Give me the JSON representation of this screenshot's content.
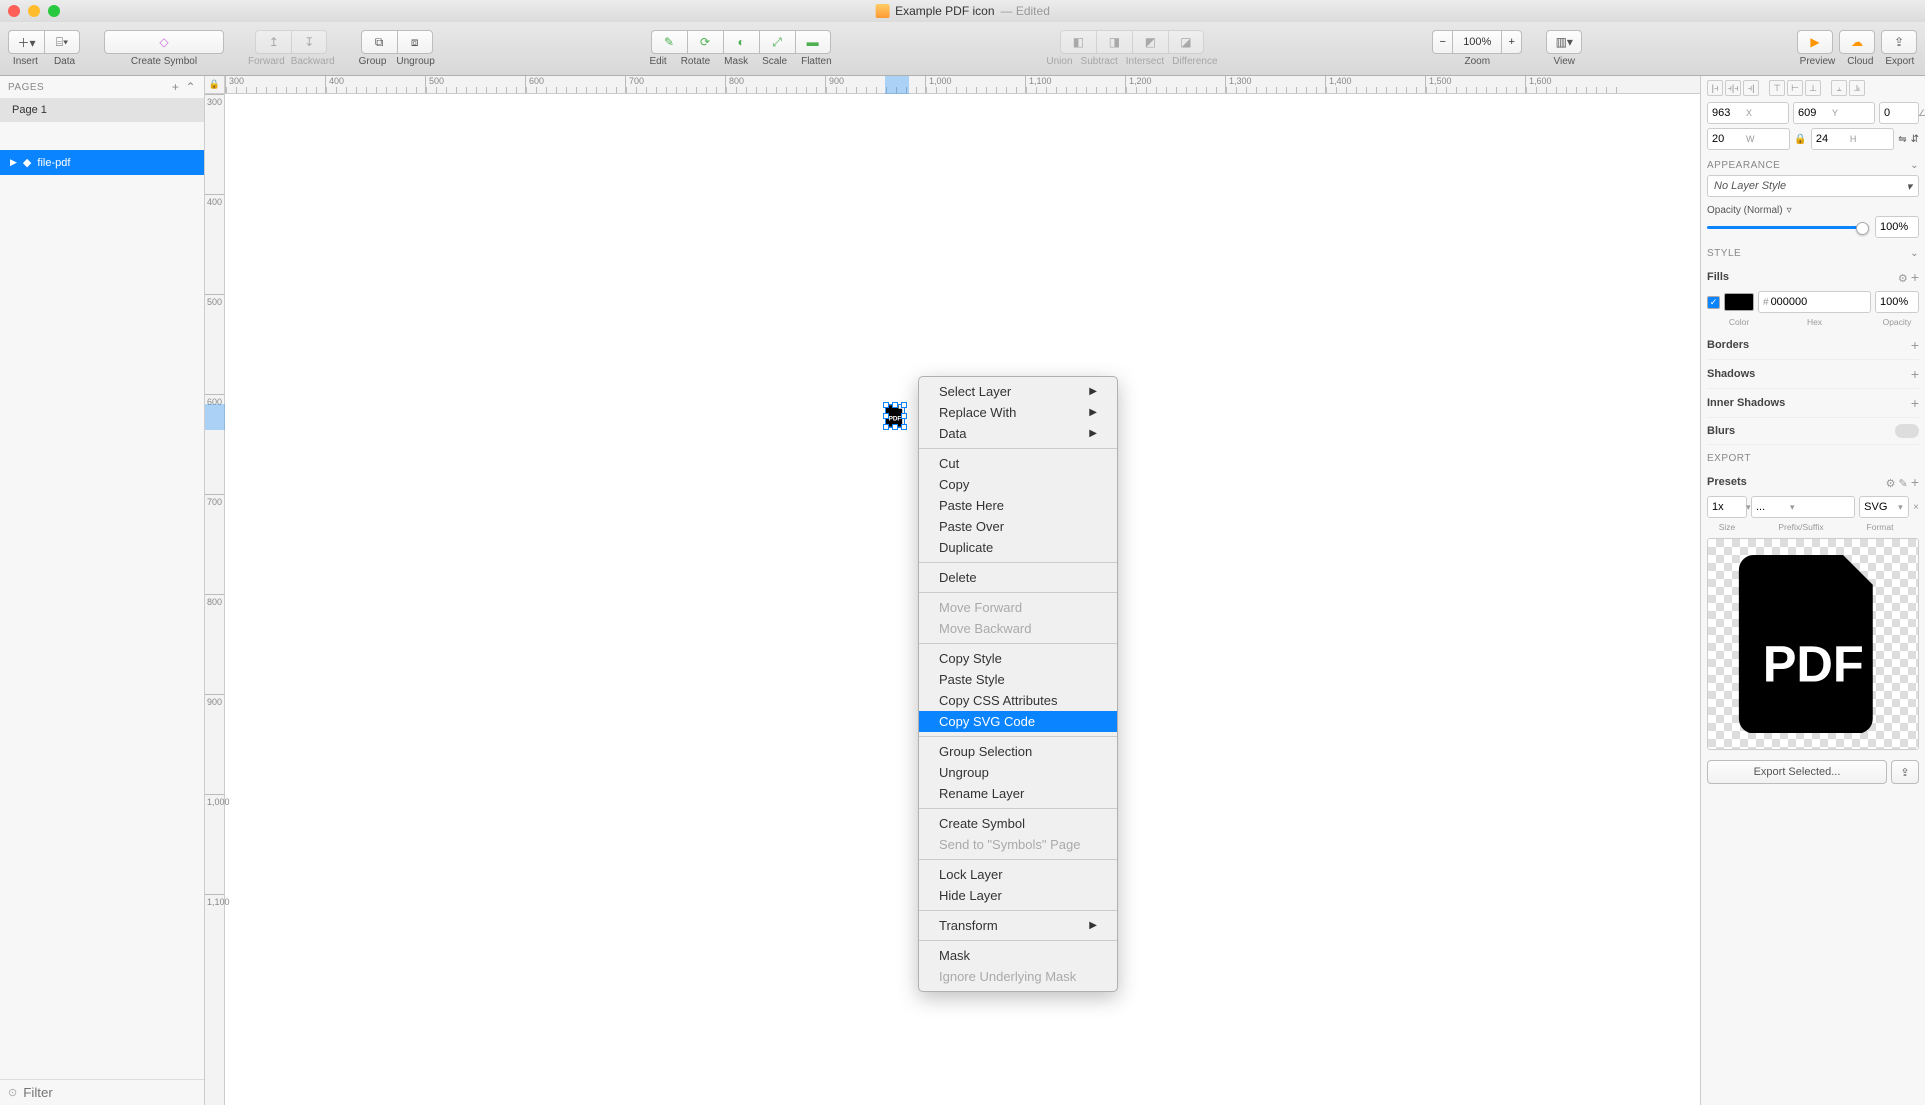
{
  "titlebar": {
    "title": "Example PDF icon",
    "edited": "— Edited"
  },
  "toolbar": {
    "insert": "Insert",
    "data": "Data",
    "create_symbol": "Create Symbol",
    "forward": "Forward",
    "backward": "Backward",
    "group": "Group",
    "ungroup": "Ungroup",
    "edit": "Edit",
    "rotate": "Rotate",
    "mask": "Mask",
    "scale": "Scale",
    "flatten": "Flatten",
    "union": "Union",
    "subtract": "Subtract",
    "intersect": "Intersect",
    "difference": "Difference",
    "zoom": "Zoom",
    "zoom_value": "100%",
    "view": "View",
    "preview": "Preview",
    "cloud": "Cloud",
    "export": "Export"
  },
  "left": {
    "pages_header": "PAGES",
    "page1": "Page 1",
    "layer": "file-pdf",
    "filter_placeholder": "Filter"
  },
  "ruler_h": [
    "300",
    "400",
    "500",
    "600",
    "700",
    "800",
    "900",
    "1,000",
    "1,100",
    "1,200",
    "1,300",
    "1,400",
    "1,500",
    "1,600"
  ],
  "ruler_v": [
    "300",
    "400",
    "500",
    "600",
    "700",
    "800",
    "900",
    "1,000",
    "1,100"
  ],
  "context_menu": {
    "select_layer": "Select Layer",
    "replace_with": "Replace With",
    "data": "Data",
    "cut": "Cut",
    "copy": "Copy",
    "paste_here": "Paste Here",
    "paste_over": "Paste Over",
    "duplicate": "Duplicate",
    "delete": "Delete",
    "move_forward": "Move Forward",
    "move_backward": "Move Backward",
    "copy_style": "Copy Style",
    "paste_style": "Paste Style",
    "copy_css": "Copy CSS Attributes",
    "copy_svg": "Copy SVG Code",
    "group_selection": "Group Selection",
    "ungroup": "Ungroup",
    "rename_layer": "Rename Layer",
    "create_symbol": "Create Symbol",
    "send_to_symbols": "Send to \"Symbols\" Page",
    "lock_layer": "Lock Layer",
    "hide_layer": "Hide Layer",
    "transform": "Transform",
    "mask": "Mask",
    "ignore_mask": "Ignore Underlying Mask"
  },
  "inspector": {
    "x": "963",
    "x_label": "X",
    "y": "609",
    "y_label": "Y",
    "rot": "0",
    "w": "20",
    "w_label": "W",
    "h": "24",
    "h_label": "H",
    "appearance": "APPEARANCE",
    "no_layer_style": "No Layer Style",
    "opacity_label": "Opacity (Normal)",
    "opacity_val": "100%",
    "style": "STYLE",
    "fills": "Fills",
    "fill_hex": "000000",
    "fill_opacity": "100%",
    "color_label": "Color",
    "hex_label": "Hex",
    "opacity_sub": "Opacity",
    "borders": "Borders",
    "shadows": "Shadows",
    "inner_shadows": "Inner Shadows",
    "blurs": "Blurs",
    "export": "EXPORT",
    "presets": "Presets",
    "size": "1x",
    "prefix": "...",
    "format": "SVG",
    "size_label": "Size",
    "prefix_label": "Prefix/Suffix",
    "format_label": "Format",
    "export_btn": "Export Selected..."
  }
}
